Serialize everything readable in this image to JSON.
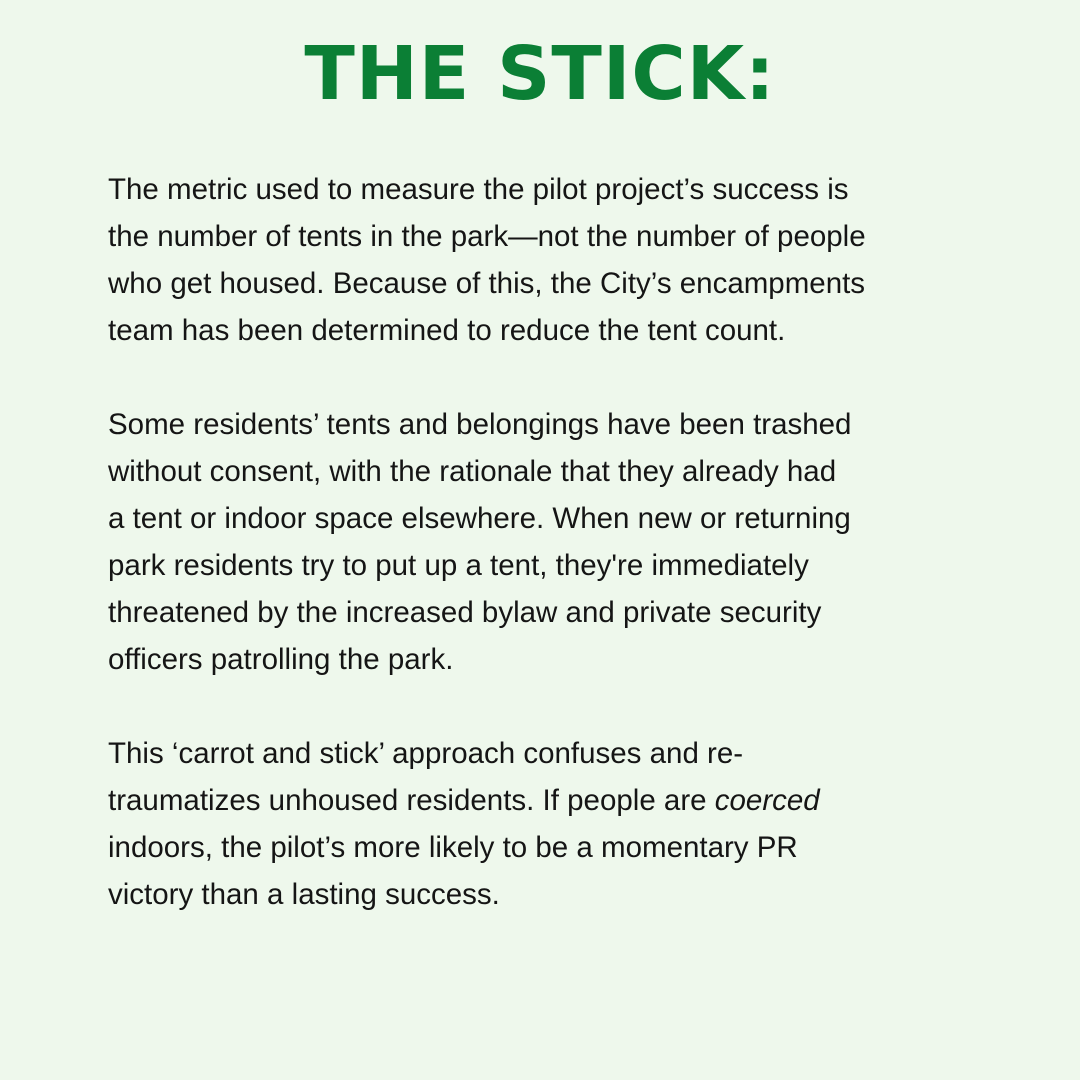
{
  "title": "THE STICK:",
  "paragraphs": [
    {
      "lines": [
        "The metric used to measure the pilot project’s success is",
        "the number of tents in the park—not the number of people",
        "who get housed. Because of this, the City’s encampments",
        "team has been determined to reduce the tent count."
      ]
    },
    {
      "lines": [
        "Some residents’ tents and belongings have been trashed",
        "without consent, with the rationale that they already had",
        "a tent or indoor space elsewhere. When new or returning",
        "park residents try to put up a tent, they're immediately",
        "threatened by the increased bylaw and private security",
        "officers patrolling the park."
      ]
    },
    {
      "line1": "This ‘carrot and stick’ approach confuses and re-",
      "line2_before": "traumatizes unhoused residents. If people are ",
      "line2_emphasis": "coerced",
      "line3": "indoors, the pilot’s more likely to be a momentary PR",
      "line4": "victory than a lasting success."
    }
  ]
}
